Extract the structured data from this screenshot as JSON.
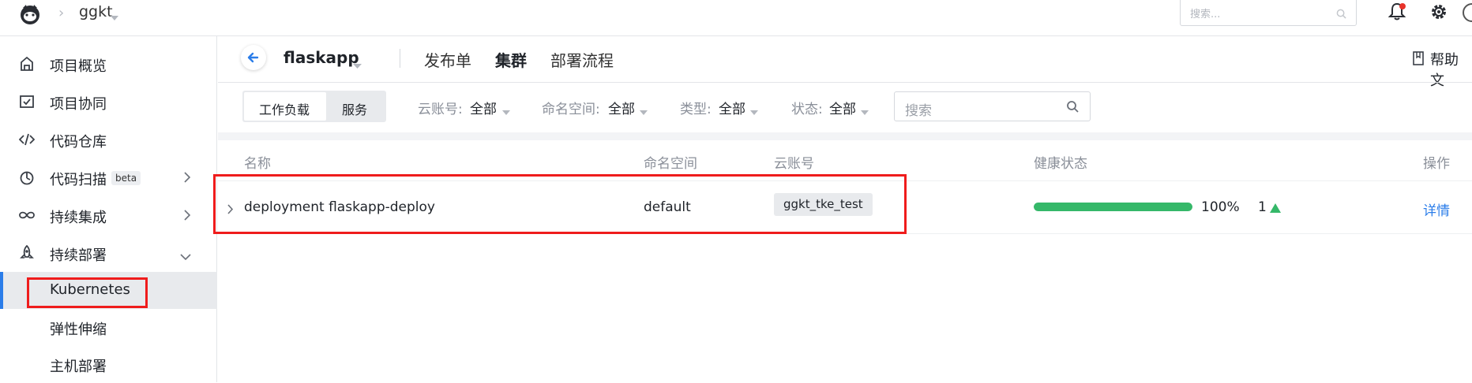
{
  "topbar": {
    "project_name": "ggkt",
    "search_placeholder": "搜索...",
    "icons": [
      "logo-icon",
      "bell-icon",
      "gear-icon"
    ]
  },
  "sidebar": {
    "items": [
      {
        "label": "项目概览",
        "icon": "home-icon"
      },
      {
        "label": "项目协同",
        "icon": "checkbox-icon"
      },
      {
        "label": "代码仓库",
        "icon": "code-icon"
      },
      {
        "label": "代码扫描",
        "icon": "scan-icon",
        "badge": "beta"
      },
      {
        "label": "持续集成",
        "icon": "infinity-icon"
      },
      {
        "label": "持续部署",
        "icon": "rocket-icon"
      }
    ],
    "subitems": [
      {
        "label": "Kubernetes",
        "active": true
      },
      {
        "label": "弹性伸缩"
      },
      {
        "label": "主机部署"
      }
    ]
  },
  "header": {
    "app_name": "flaskapp",
    "tabs": [
      {
        "label": "发布单"
      },
      {
        "label": "集群",
        "active": true
      },
      {
        "label": "部署流程"
      }
    ],
    "help_label": "帮助文"
  },
  "filters": {
    "segment": [
      "工作负载",
      "服务"
    ],
    "cloud_account": {
      "key": "云账号:",
      "value": "全部"
    },
    "namespace": {
      "key": "命名空间:",
      "value": "全部"
    },
    "type": {
      "key": "类型:",
      "value": "全部"
    },
    "status": {
      "key": "状态:",
      "value": "全部"
    },
    "search_placeholder": "搜索"
  },
  "table": {
    "columns": [
      "名称",
      "命名空间",
      "云账号",
      "健康状态",
      "操作"
    ],
    "rows": [
      {
        "name": "deployment flaskapp-deploy",
        "namespace": "default",
        "cloud_account": "ggkt_tke_test",
        "health_percent": "100%",
        "health_fraction": 1.0,
        "replicas": "1",
        "action": "详情"
      }
    ]
  },
  "colors": {
    "accent": "#2b7de9",
    "health": "#35b869",
    "highlight": "#ef1c1c"
  }
}
